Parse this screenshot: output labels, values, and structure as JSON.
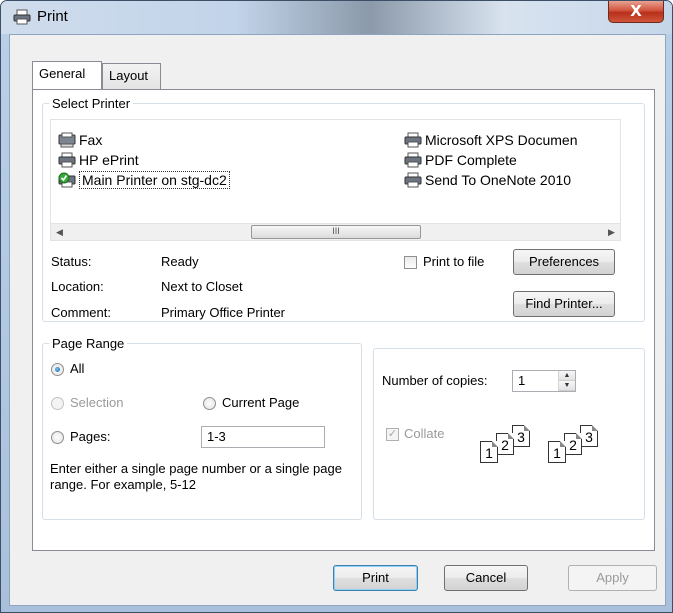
{
  "window": {
    "title": "Print",
    "close_label": "X"
  },
  "tabs": [
    {
      "label": "General",
      "active": true
    },
    {
      "label": "Layout",
      "active": false
    }
  ],
  "select_printer": {
    "legend": "Select Printer",
    "printers": [
      {
        "label": "Fax",
        "icon": "fax-icon"
      },
      {
        "label": "HP ePrint",
        "icon": "printer-icon"
      },
      {
        "label": "Main Printer on stg-dc2",
        "icon": "network-printer-icon",
        "selected": true
      },
      {
        "label": "Microsoft XPS Documen",
        "icon": "printer-icon"
      },
      {
        "label": "PDF Complete",
        "icon": "printer-icon"
      },
      {
        "label": "Send To OneNote 2010",
        "icon": "printer-icon"
      }
    ],
    "scrollbar_grip": "III",
    "status_label": "Status:",
    "status_value": "Ready",
    "location_label": "Location:",
    "location_value": "Next to Closet",
    "comment_label": "Comment:",
    "comment_value": "Primary Office Printer",
    "print_to_file_label": "Print to file",
    "print_to_file_checked": false,
    "preferences_label": "Preferences",
    "find_printer_label": "Find Printer..."
  },
  "page_range": {
    "legend": "Page Range",
    "all_label": "All",
    "selection_label": "Selection",
    "current_page_label": "Current Page",
    "pages_label": "Pages:",
    "pages_value": "1-3",
    "selected": "All",
    "hint": "Enter either a single page number or a single page range.  For example, 5-12"
  },
  "copies": {
    "label": "Number of copies:",
    "value": "1",
    "collate_label": "Collate",
    "collate_checked": true,
    "collate_pages": [
      "1",
      "2",
      "3"
    ]
  },
  "footer": {
    "print_label": "Print",
    "cancel_label": "Cancel",
    "apply_label": "Apply"
  }
}
